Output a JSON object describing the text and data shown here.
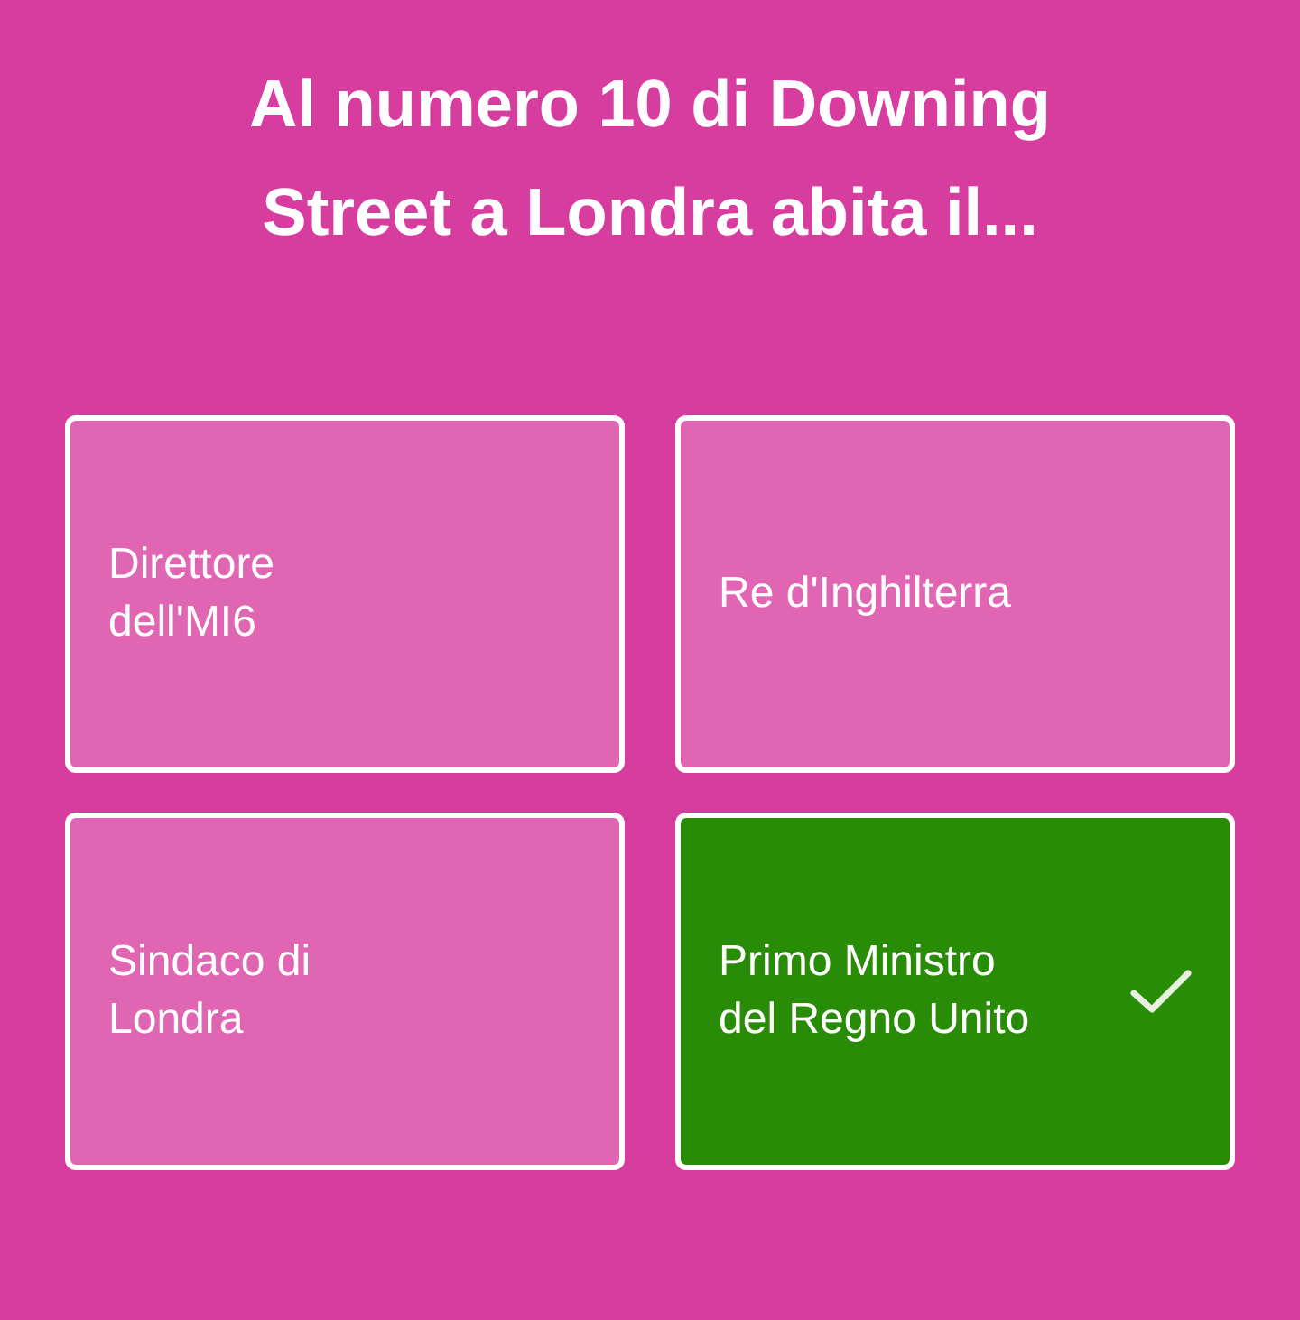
{
  "question": "Al numero 10 di Downing Street a Londra abita il...",
  "answers": [
    {
      "label": "Direttore dell'MI6",
      "selected": false
    },
    {
      "label": "Re d'Inghilterra",
      "selected": false
    },
    {
      "label": "Sindaco di Londra",
      "selected": false
    },
    {
      "label": "Primo Ministro del Regno Unito",
      "selected": true
    }
  ]
}
